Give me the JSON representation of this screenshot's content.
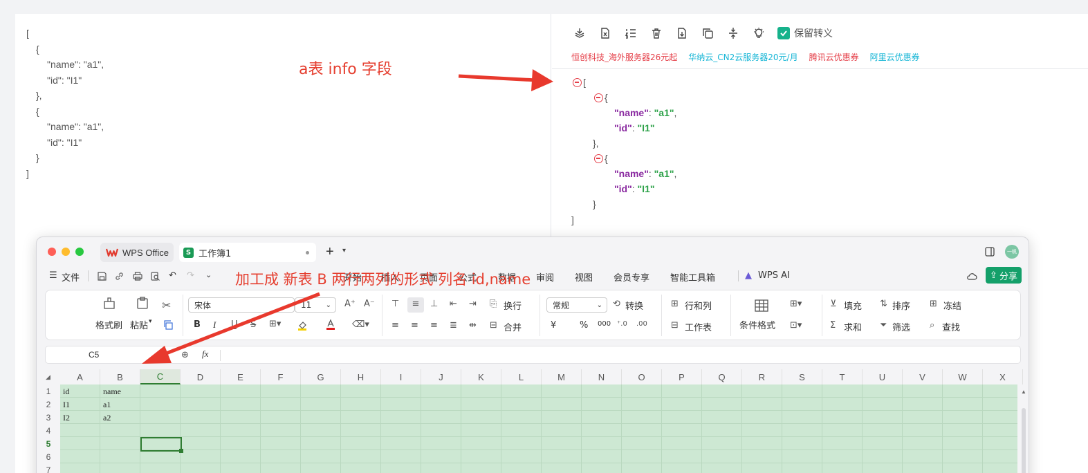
{
  "raw_json": {
    "lines": [
      "[",
      "{",
      "\"name\": \"a1\",",
      "\"id\": \"I1\"",
      "},",
      "{",
      "\"name\": \"a1\",",
      "\"id\": \"I1\"",
      "}",
      "]"
    ]
  },
  "annotations": {
    "top": "a表 info 字段",
    "bottom": "加工成 新表 B  两行两列的形式 列名 id,name"
  },
  "formatter": {
    "toolbar_icons": [
      "layers-icon",
      "excel-icon",
      "list-number-icon",
      "trash-icon",
      "download-icon",
      "copy-icon",
      "compress-icon",
      "bulb-icon"
    ],
    "keep_escape_label": "保留转义",
    "ads": [
      {
        "text": "恒创科技_海外服务器26元起",
        "color": "#e5404a"
      },
      {
        "text": "华纳云_CN2云服务器20元/月",
        "color": "#17b6d6"
      },
      {
        "text": "腾讯云优惠券",
        "color": "#e5404a"
      },
      {
        "text": "阿里云优惠券",
        "color": "#17b6d6"
      }
    ],
    "open_bracket": "[",
    "close_bracket": "]",
    "open_brace": "{",
    "close_brace": "},",
    "close_brace_last": "}",
    "key_name": "\"name\"",
    "key_id": "\"id\"",
    "colon": ":",
    "comma": ",",
    "val_a1": "\"a1\"",
    "val_i1": "\"I1\""
  },
  "wps": {
    "tab_app": "WPS Office",
    "tab_book": "工作簿1",
    "tab_book_badge": "S",
    "avatar_text": "一帆",
    "file_menu": "文件",
    "menu": [
      "开始",
      "插入",
      "页面",
      "公式",
      "数据",
      "审阅",
      "视图",
      "会员专享",
      "智能工具箱",
      "WPS AI"
    ],
    "share": "分享",
    "ribbon": {
      "format_painter": "格式刷",
      "paste": "粘贴",
      "font_name": "宋体",
      "font_size": "11",
      "wrap": "换行",
      "merge": "合并",
      "number_format": "常规",
      "convert": "转换",
      "rows_cols": "行和列",
      "worksheet": "工作表",
      "cond_format": "条件格式",
      "fill": "填充",
      "sort": "排序",
      "freeze": "冻结",
      "sum": "求和",
      "filter": "筛选",
      "find": "查找",
      "bold": "B",
      "italic": "I",
      "currency": "¥",
      "percent": "%",
      "thousand": "000"
    },
    "name_box": "C5",
    "fx": "fx",
    "columns": [
      "A",
      "B",
      "C",
      "D",
      "E",
      "F",
      "G",
      "H",
      "I",
      "J",
      "K",
      "L",
      "M",
      "N",
      "O",
      "P",
      "Q",
      "R",
      "S",
      "T",
      "U",
      "V",
      "W",
      "X"
    ],
    "rows": [
      "1",
      "2",
      "3",
      "4",
      "5",
      "6",
      "7"
    ],
    "cells": [
      [
        "id",
        "name"
      ],
      [
        "I1",
        "a1"
      ],
      [
        "I2",
        "a2"
      ]
    ],
    "colors": {
      "sheet_fill": "#cde8d3",
      "active": "#2f7d32",
      "share": "#14a06a",
      "annotation": "#e53e2f"
    }
  }
}
